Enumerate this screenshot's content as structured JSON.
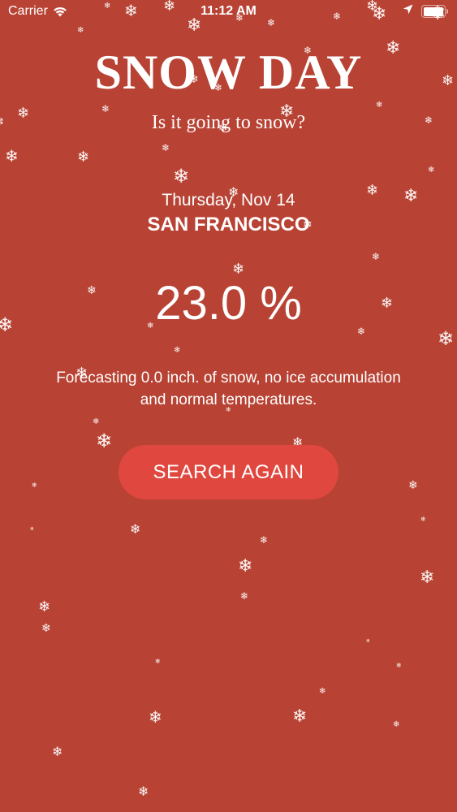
{
  "status_bar": {
    "carrier": "Carrier",
    "time": "11:12 AM"
  },
  "app": {
    "title": "SNOW DAY",
    "subtitle": "Is it going to snow?"
  },
  "forecast": {
    "date": "Thursday, Nov 14",
    "city": "SAN FRANCISCO",
    "chance": "23.0 %",
    "line1": "Forecasting 0.0 inch. of snow, no ice accumulation",
    "line2": "and normal temperatures."
  },
  "actions": {
    "search_again": "SEARCH AGAIN"
  },
  "theme": {
    "background": "#b84334",
    "button": "#e0473e",
    "text": "#ffffff"
  },
  "icons": [
    "wifi-icon",
    "location-arrow-icon",
    "battery-icon",
    "snowflake-icon"
  ]
}
